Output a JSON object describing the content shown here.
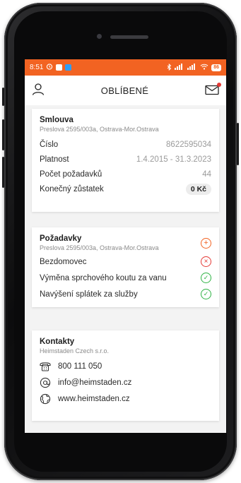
{
  "status_bar": {
    "time": "8:51",
    "battery": "86"
  },
  "header": {
    "title": "OBLÍBENÉ",
    "left_icon": "user-icon",
    "right_icon": "mail-icon"
  },
  "contract": {
    "title": "Smlouva",
    "address": "Preslova 2595/003a, Ostrava-Mor.Ostrava",
    "rows": [
      {
        "label": "Číslo",
        "value": "8622595034"
      },
      {
        "label": "Platnost",
        "value": "1.4.2015 - 31.3.2023"
      },
      {
        "label": "Počet požadavků",
        "value": "44"
      },
      {
        "label": "Konečný zůstatek",
        "value": "0 Kč"
      }
    ]
  },
  "requests": {
    "title": "Požadavky",
    "address": "Preslova 2595/003a, Ostrava-Mor.Ostrava",
    "items": [
      {
        "label": "Bezdomovec",
        "status": "rejected"
      },
      {
        "label": "Výměna sprchového koutu za vanu",
        "status": "done"
      },
      {
        "label": "Navýšení splátek za služby",
        "status": "done"
      }
    ]
  },
  "contacts": {
    "title": "Kontakty",
    "company": "Heimstaden Czech s.r.o.",
    "phone": "800 111 050",
    "email": "info@heimstaden.cz",
    "web": "www.heimstaden.cz"
  },
  "colors": {
    "accent": "#f26322",
    "add": "#f26322",
    "rejected": "#e53935",
    "done": "#2fb344"
  }
}
